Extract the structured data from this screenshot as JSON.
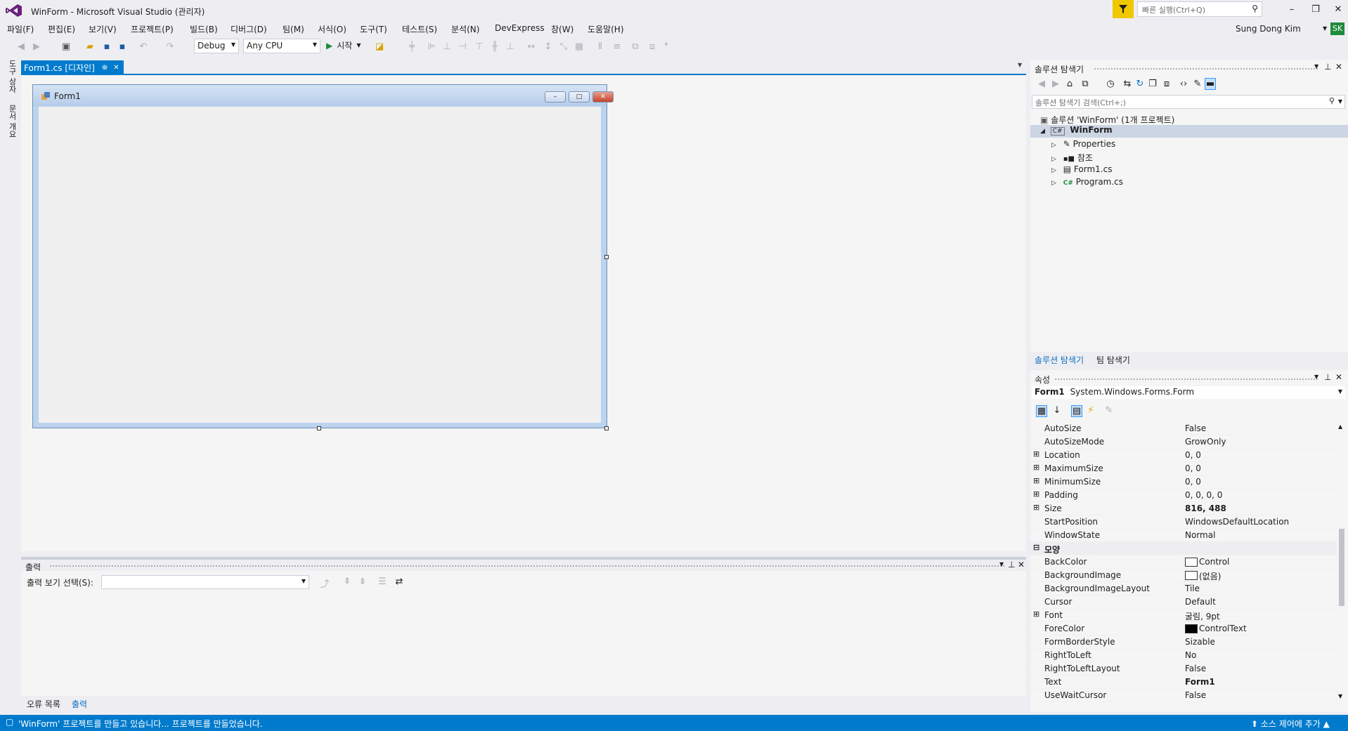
{
  "titlebar": {
    "title": "WinForm - Microsoft Visual Studio (관리자)",
    "quick_launch_placeholder": "빠른 실행(Ctrl+Q)",
    "user": "Sung Dong Kim",
    "avatar": "SK"
  },
  "menu": [
    "파일(F)",
    "편집(E)",
    "보기(V)",
    "프로젝트(P)",
    "빌드(B)",
    "디버그(D)",
    "팀(M)",
    "서식(O)",
    "도구(T)",
    "테스트(S)",
    "분석(N)",
    "DevExpress",
    "창(W)",
    "도움말(H)"
  ],
  "toolbar": {
    "config": "Debug",
    "platform": "Any CPU",
    "start": "시작"
  },
  "left_tabs": [
    "도구 상자",
    "문서 개요"
  ],
  "doc_tab": {
    "label": "Form1.cs [디자인]",
    "pin": "⊕",
    "close": "✕"
  },
  "form": {
    "title": "Form1"
  },
  "output": {
    "title": "출력",
    "select_label": "출력 보기 선택(S):",
    "select_value": "",
    "tabs": [
      "오류 목록",
      "출력"
    ]
  },
  "solution_explorer": {
    "title": "솔루션 탐색기",
    "search_placeholder": "솔루션 탐색기 검색(Ctrl+;)",
    "solution": "솔루션 'WinForm' (1개 프로젝트)",
    "project": "WinForm",
    "project_badge": "C#",
    "items": [
      "Properties",
      "참조",
      "Form1.cs",
      "Program.cs"
    ],
    "program_badge": "C#",
    "tabs": [
      "솔루션 탐색기",
      "팀 탐색기"
    ]
  },
  "properties": {
    "title": "속성",
    "object": "Form1",
    "object_type": "System.Windows.Forms.Form",
    "rows": [
      {
        "name": "AutoSize",
        "value": "False",
        "expand": ""
      },
      {
        "name": "AutoSizeMode",
        "value": "GrowOnly",
        "expand": ""
      },
      {
        "name": "Location",
        "value": "0, 0",
        "expand": "⊞"
      },
      {
        "name": "MaximumSize",
        "value": "0, 0",
        "expand": "⊞"
      },
      {
        "name": "MinimumSize",
        "value": "0, 0",
        "expand": "⊞"
      },
      {
        "name": "Padding",
        "value": "0, 0, 0, 0",
        "expand": "⊞"
      },
      {
        "name": "Size",
        "value": "816, 488",
        "expand": "⊞",
        "bold": true
      },
      {
        "name": "StartPosition",
        "value": "WindowsDefaultLocation",
        "expand": ""
      },
      {
        "name": "WindowState",
        "value": "Normal",
        "expand": ""
      },
      {
        "name": "모양",
        "value": "",
        "expand": "⊟",
        "category": true
      },
      {
        "name": "BackColor",
        "value": "Control",
        "expand": "",
        "swatch": "#ffffff"
      },
      {
        "name": "BackgroundImage",
        "value": "(없음)",
        "expand": "",
        "swatch": "#ffffff"
      },
      {
        "name": "BackgroundImageLayout",
        "value": "Tile",
        "expand": ""
      },
      {
        "name": "Cursor",
        "value": "Default",
        "expand": ""
      },
      {
        "name": "Font",
        "value": "굴림, 9pt",
        "expand": "⊞"
      },
      {
        "name": "ForeColor",
        "value": "ControlText",
        "expand": "",
        "swatch": "#000000"
      },
      {
        "name": "FormBorderStyle",
        "value": "Sizable",
        "expand": ""
      },
      {
        "name": "RightToLeft",
        "value": "No",
        "expand": ""
      },
      {
        "name": "RightToLeftLayout",
        "value": "False",
        "expand": ""
      },
      {
        "name": "Text",
        "value": "Form1",
        "expand": "",
        "bold": true
      },
      {
        "name": "UseWaitCursor",
        "value": "False",
        "expand": ""
      }
    ]
  },
  "statusbar": {
    "message": "'WinForm' 프로젝트를 만들고 있습니다... 프로젝트를 만들었습니다.",
    "source_control": "소스 제어에 추가"
  },
  "colors": {
    "accent": "#007acc",
    "filter": "#f0c800",
    "avatar": "#1f8c3c"
  }
}
